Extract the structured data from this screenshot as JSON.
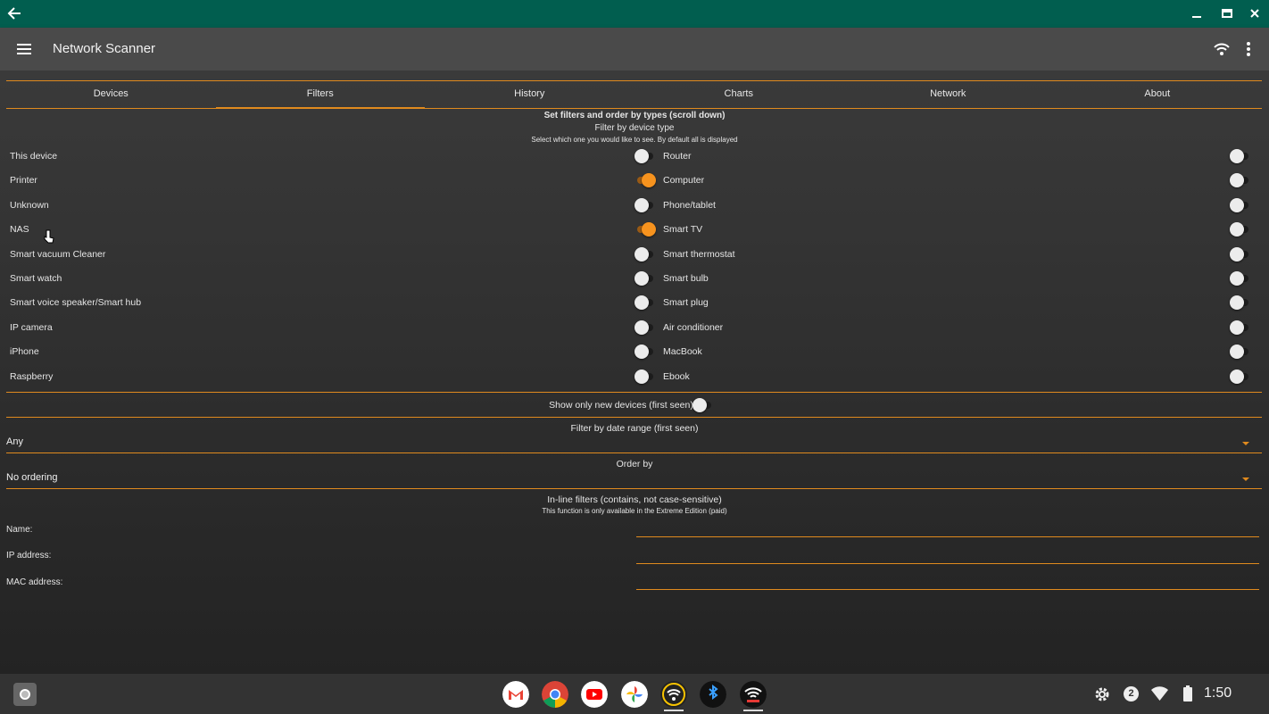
{
  "app": {
    "title": "Network Scanner"
  },
  "tabs": [
    {
      "label": "Devices"
    },
    {
      "label": "Filters",
      "active": true
    },
    {
      "label": "History"
    },
    {
      "label": "Charts"
    },
    {
      "label": "Network"
    },
    {
      "label": "About"
    }
  ],
  "header": {
    "line1": "Set filters and order by types (scroll down)",
    "line2": "Filter by device type",
    "line3": "Select which one you would like to see. By default all is displayed"
  },
  "device_filters_left": [
    {
      "label": "This device",
      "on": false
    },
    {
      "label": "Printer",
      "on": true
    },
    {
      "label": "Unknown",
      "on": false
    },
    {
      "label": "NAS",
      "on": true
    },
    {
      "label": "Smart vacuum Cleaner",
      "on": false
    },
    {
      "label": "Smart watch",
      "on": false
    },
    {
      "label": "Smart voice speaker/Smart hub",
      "on": false
    },
    {
      "label": "IP camera",
      "on": false
    },
    {
      "label": "iPhone",
      "on": false
    },
    {
      "label": "Raspberry",
      "on": false
    }
  ],
  "device_filters_right": [
    {
      "label": "Router",
      "on": true
    },
    {
      "label": "Computer",
      "on": true
    },
    {
      "label": "Phone/tablet",
      "on": true
    },
    {
      "label": "Smart TV",
      "on": true
    },
    {
      "label": "Smart thermostat",
      "on": true
    },
    {
      "label": "Smart bulb",
      "on": true
    },
    {
      "label": "Smart plug",
      "on": true
    },
    {
      "label": "Air conditioner",
      "on": true
    },
    {
      "label": "MacBook",
      "on": true
    },
    {
      "label": "Ebook",
      "on": true
    }
  ],
  "new_devices": {
    "label": "Show only new devices (first seen)",
    "on": false
  },
  "date_range": {
    "title": "Filter by date range (first seen)",
    "value": "Any"
  },
  "order_by": {
    "title": "Order by",
    "value": "No ordering"
  },
  "inline_filters": {
    "title": "In-line filters (contains, not case-sensitive)",
    "note": "This function is only available in the Extreme Edition (paid)",
    "fields": [
      {
        "label": "Name:",
        "value": ""
      },
      {
        "label": "IP address:",
        "value": ""
      },
      {
        "label": "MAC address:",
        "value": ""
      }
    ]
  },
  "shelf": {
    "apps": [
      "gmail-icon",
      "chrome-icon",
      "youtube-icon",
      "photos-icon",
      "wifi-scanner-icon",
      "bluetooth-scanner-icon",
      "network-scanner-icon"
    ],
    "clock": "1:50",
    "notification_count": "2"
  },
  "colors": {
    "accent": "#e08a1e",
    "titlebar": "#015e4f",
    "appbar": "#4a4a4a"
  }
}
